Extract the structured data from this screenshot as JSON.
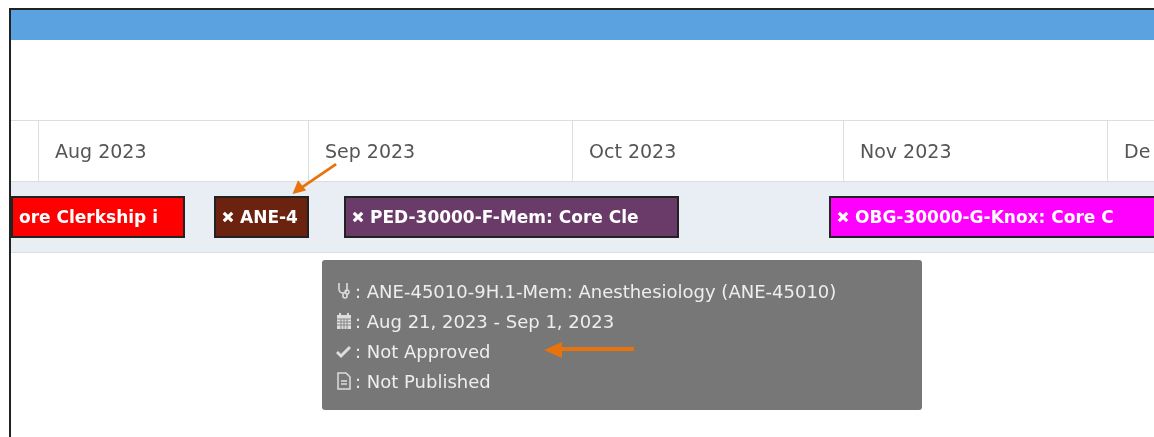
{
  "months": [
    "Aug 2023",
    "Sep 2023",
    "Oct 2023",
    "Nov 2023",
    "De"
  ],
  "events": [
    {
      "label": "ore Clerkship i",
      "color": "#ff0000",
      "removable": false
    },
    {
      "label": "ANE-4",
      "color": "#6b2310",
      "removable": true
    },
    {
      "label": "PED-30000-F-Mem: Core Cle",
      "color": "#6a3b69",
      "removable": true
    },
    {
      "label": "OBG-30000-G-Knox: Core C",
      "color": "#ff00ff",
      "removable": true
    }
  ],
  "tooltip": {
    "rows": [
      {
        "kind": "rotation",
        "text": ": ANE-45010-9H.1-Mem: Anesthesiology (ANE-45010)"
      },
      {
        "kind": "dates",
        "text": ": Aug 21, 2023 - Sep 1, 2023"
      },
      {
        "kind": "approval",
        "text": ": Not Approved"
      },
      {
        "kind": "publish",
        "text": ": Not Published"
      }
    ]
  }
}
